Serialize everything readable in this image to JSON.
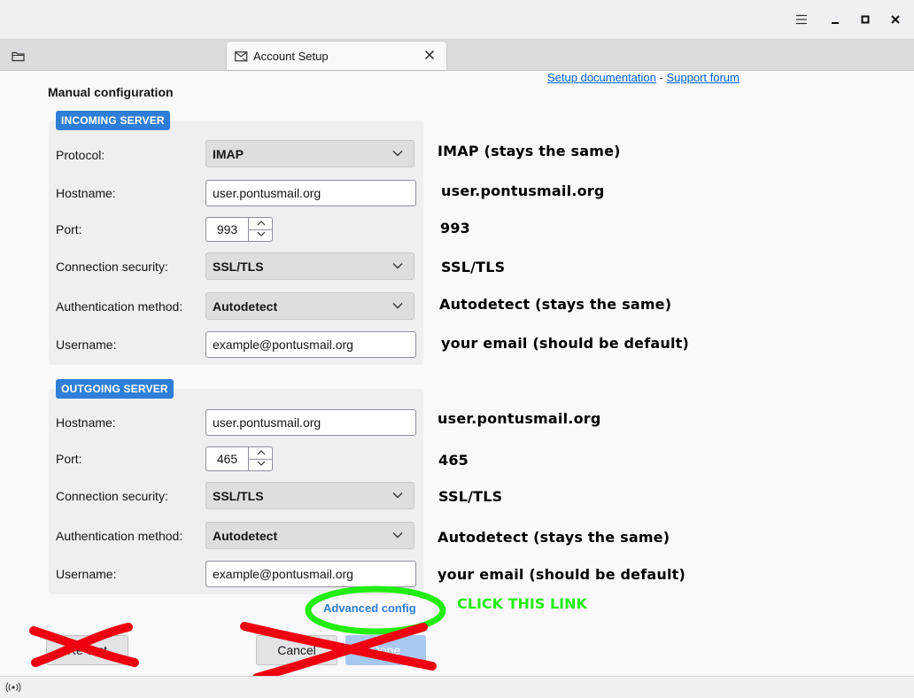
{
  "window": {
    "menu_icon": "hamburger-menu-icon",
    "minimize_icon": "minimize-icon",
    "maximize_icon": "maximize-icon",
    "close_icon": "close-icon"
  },
  "tabs": {
    "folder_icon": "folder-icon",
    "active": {
      "icon": "mail-setup-icon",
      "title": "Account Setup"
    }
  },
  "header": {
    "setup_doc": "Setup documentation",
    "separator": "-",
    "support_forum": "Support forum"
  },
  "page_title": "Manual configuration",
  "incoming": {
    "badge": "INCOMING SERVER",
    "protocol_label": "Protocol:",
    "protocol": "IMAP",
    "hostname_label": "Hostname:",
    "hostname": "user.pontusmail.org",
    "port_label": "Port:",
    "port": "993",
    "security_label": "Connection security:",
    "security": "SSL/TLS",
    "auth_label": "Authentication method:",
    "auth": "Autodetect",
    "username_label": "Username:",
    "username": "example@pontusmail.org"
  },
  "outgoing": {
    "badge": "OUTGOING SERVER",
    "hostname_label": "Hostname:",
    "hostname": "user.pontusmail.org",
    "port_label": "Port:",
    "port": "465",
    "security_label": "Connection security:",
    "security": "SSL/TLS",
    "auth_label": "Authentication method:",
    "auth": "Autodetect",
    "username_label": "Username:",
    "username": "example@pontusmail.org"
  },
  "annotations": {
    "in_protocol": "IMAP (stays the same)",
    "in_hostname": "user.pontusmail.org",
    "in_port": "993",
    "in_security": "SSL/TLS",
    "in_auth": "Autodetect (stays the same)",
    "in_username": "your email (should be default)",
    "out_hostname": "user.pontusmail.org",
    "out_port": "465",
    "out_security": "SSL/TLS",
    "out_auth": "Autodetect (stays the same)",
    "out_username": "your email (should be default)",
    "click_hint": "CLICK THIS LINK",
    "highlight_color": "#22ee11",
    "cross_color": "#ee0011"
  },
  "footer": {
    "advanced_config": "Advanced config",
    "left_button": "Re-test",
    "cancel_button": "Cancel",
    "done_button": "Done"
  },
  "statusbar": {
    "icon": "connection-status-icon"
  }
}
